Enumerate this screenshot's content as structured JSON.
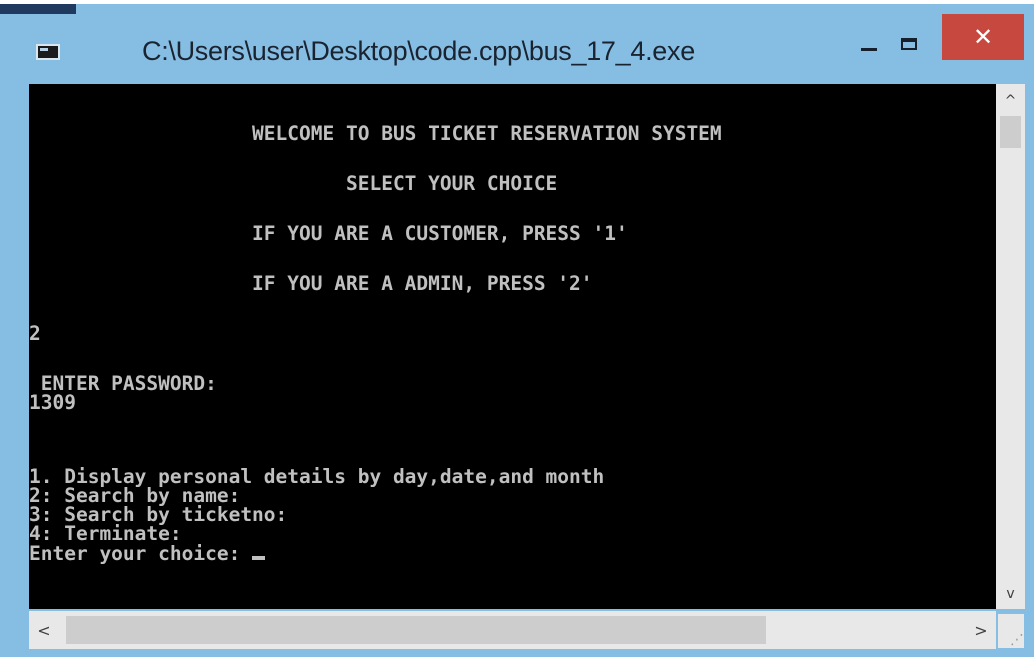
{
  "window": {
    "title": "C:\\Users\\user\\Desktop\\code.cpp\\bus_17_4.exe",
    "close_glyph": "✕"
  },
  "console": {
    "lines": [
      "                   WELCOME TO BUS TICKET RESERVATION SYSTEM",
      "                           SELECT YOUR CHOICE",
      "                   IF YOU ARE A CUSTOMER, PRESS '1'",
      "                   IF YOU ARE A ADMIN, PRESS '2'",
      "2",
      " ENTER PASSWORD:",
      "1309",
      "1. Display personal details by day,date,and month",
      "2: Search by name:",
      "3: Search by ticketno:",
      "4: Terminate:",
      "Enter your choice: "
    ]
  },
  "scrollbars": {
    "up": "^",
    "down": "v",
    "left": "<",
    "right": ">"
  }
}
